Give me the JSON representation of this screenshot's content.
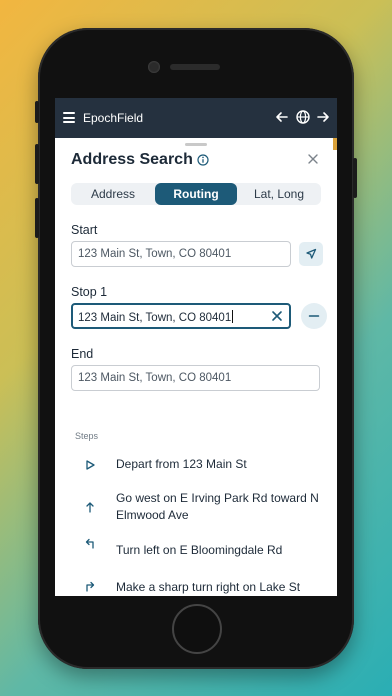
{
  "app": {
    "title": "EpochField"
  },
  "header_icons": [
    "menu-icon",
    "back-arrow-icon",
    "globe-icon",
    "forward-arrow-icon"
  ],
  "panel": {
    "title": "Address Search",
    "tabs": [
      {
        "label": "Address",
        "active": false
      },
      {
        "label": "Routing",
        "active": true
      },
      {
        "label": "Lat, Long",
        "active": false
      }
    ]
  },
  "fields": {
    "start": {
      "label": "Start",
      "value": "123 Main St, Town, CO 80401"
    },
    "stop1": {
      "label": "Stop 1",
      "value": "123 Main St, Town, CO 80401"
    },
    "end": {
      "label": "End",
      "value": "123 Main St, Town, CO 80401"
    }
  },
  "steps": {
    "label": "Steps",
    "items": [
      {
        "icon": "play-triangle-icon",
        "text": "Depart from 123 Main St"
      },
      {
        "icon": "arrow-up-icon",
        "text": "Go west on E Irving Park Rd toward N Elmwood Ave"
      },
      {
        "icon": "turn-left-icon",
        "text": "Turn left on E Bloomingdale Rd"
      },
      {
        "icon": "sharp-right-icon",
        "text": "Make a sharp turn right on Lake St"
      }
    ]
  },
  "colors": {
    "accent": "#1d5a78",
    "header_bg": "#25313f",
    "accent_light": "#e3eef3"
  }
}
